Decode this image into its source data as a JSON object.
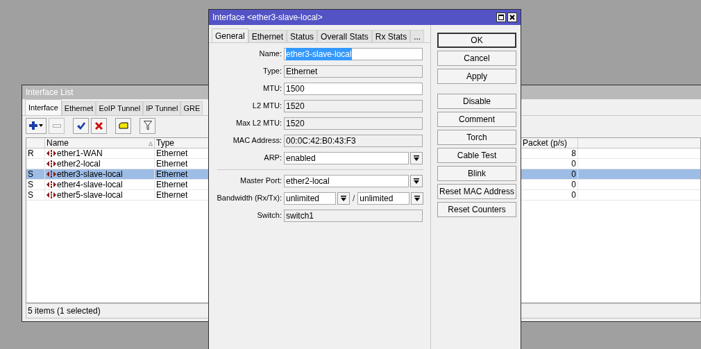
{
  "interface_list": {
    "title": "Interface List",
    "tabs": [
      {
        "label": "Interface",
        "selected": true
      },
      {
        "label": "Ethernet",
        "selected": false
      },
      {
        "label": "EoIP Tunnel",
        "selected": false
      },
      {
        "label": "IP Tunnel",
        "selected": false
      },
      {
        "label": "GRE",
        "selected": false
      }
    ],
    "columns": [
      "Name",
      "Type",
      "Packet (p/s)"
    ],
    "rows": [
      {
        "flag": "R",
        "name": "ether1-WAN",
        "type": "Ethernet",
        "packet": "8",
        "selected": false
      },
      {
        "name": "ether2-local",
        "type": "Ethernet",
        "packet": "0",
        "selected": false
      },
      {
        "flag": "S",
        "name": "ether3-slave-local",
        "type": "Ethernet",
        "packet": "0",
        "selected": true
      },
      {
        "flag": "S",
        "name": "ether4-slave-local",
        "type": "Ethernet",
        "packet": "0",
        "selected": false
      },
      {
        "flag": "S",
        "name": "ether5-slave-local",
        "type": "Ethernet",
        "packet": "0",
        "selected": false
      }
    ],
    "status": "5 items (1 selected)"
  },
  "dialog": {
    "title": "Interface <ether3-slave-local>",
    "tabs": [
      {
        "label": "General",
        "selected": true
      },
      {
        "label": "Ethernet",
        "selected": false
      },
      {
        "label": "Status",
        "selected": false
      },
      {
        "label": "Overall Stats",
        "selected": false
      },
      {
        "label": "Rx Stats",
        "selected": false
      },
      {
        "label": "...",
        "selected": false
      }
    ],
    "fields": [
      {
        "kind": "text",
        "label": "Name:",
        "value": "ether3-slave-local",
        "highlighted": true
      },
      {
        "kind": "readonly",
        "label": "Type:",
        "value": "Ethernet"
      },
      {
        "kind": "text",
        "label": "MTU:",
        "value": "1500",
        "highlighted": false
      },
      {
        "kind": "readonly",
        "label": "L2 MTU:",
        "value": "1520"
      },
      {
        "kind": "readonly",
        "label": "Max L2 MTU:",
        "value": "1520"
      },
      {
        "kind": "readonly",
        "label": "MAC Address:",
        "value": "00:0C:42:B0:43:F3"
      },
      {
        "kind": "dropdown",
        "label": "ARP:",
        "value": "enabled"
      },
      {
        "kind": "separator"
      },
      {
        "kind": "dropdown",
        "label": "Master Port:",
        "value": "ether2-local"
      },
      {
        "kind": "pair",
        "label": "Bandwidth (Rx/Tx):",
        "value": "unlimited",
        "separator": "/",
        "value2": "unlimited"
      },
      {
        "kind": "readonly",
        "label": "Switch:",
        "value": "switch1"
      }
    ],
    "buttons": [
      {
        "label": "OK",
        "default": true
      },
      {
        "label": "Cancel",
        "default": false
      },
      {
        "label": "Apply",
        "default": false
      }
    ],
    "action_buttons": [
      {
        "label": "Disable",
        "default": false
      },
      {
        "label": "Comment",
        "default": false
      },
      {
        "label": "Torch",
        "default": false
      },
      {
        "label": "Cable Test",
        "default": false
      },
      {
        "label": "Blink",
        "default": false
      },
      {
        "label": "Reset MAC Address",
        "default": false
      },
      {
        "label": "Reset Counters",
        "default": false
      }
    ]
  }
}
